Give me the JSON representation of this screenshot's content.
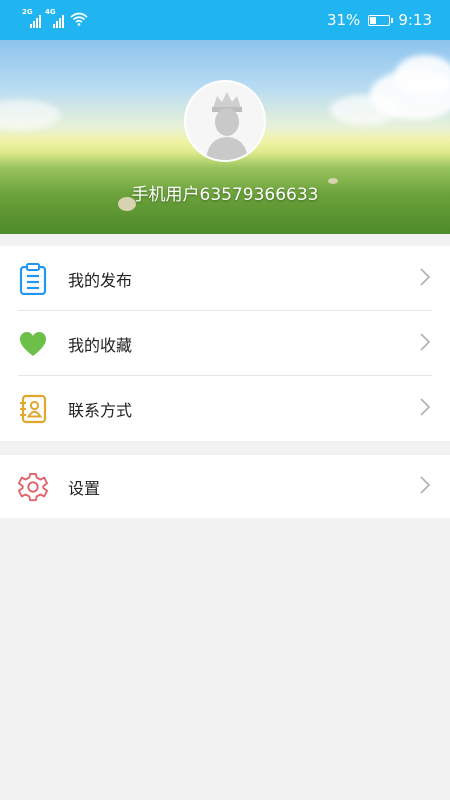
{
  "status_bar": {
    "net1": "2G",
    "net2": "4G",
    "battery": "31%",
    "battery_level": 0.31,
    "time": "9:13"
  },
  "profile": {
    "username": "手机用户63579366633",
    "avatar_icon": "default-avatar-icon"
  },
  "menu": {
    "group1": [
      {
        "label": "我的发布",
        "icon": "clipboard-list-icon",
        "color": "#2196f3"
      },
      {
        "label": "我的收藏",
        "icon": "heart-icon",
        "color": "#6cc04a"
      },
      {
        "label": "联系方式",
        "icon": "contact-book-icon",
        "color": "#e0a72f"
      }
    ],
    "group2": [
      {
        "label": "设置",
        "icon": "gear-icon",
        "color": "#e0626b"
      }
    ]
  },
  "colors": {
    "accent": "#20b5f0",
    "background": "#f2f2f2",
    "chevron": "#b0b0b0"
  }
}
